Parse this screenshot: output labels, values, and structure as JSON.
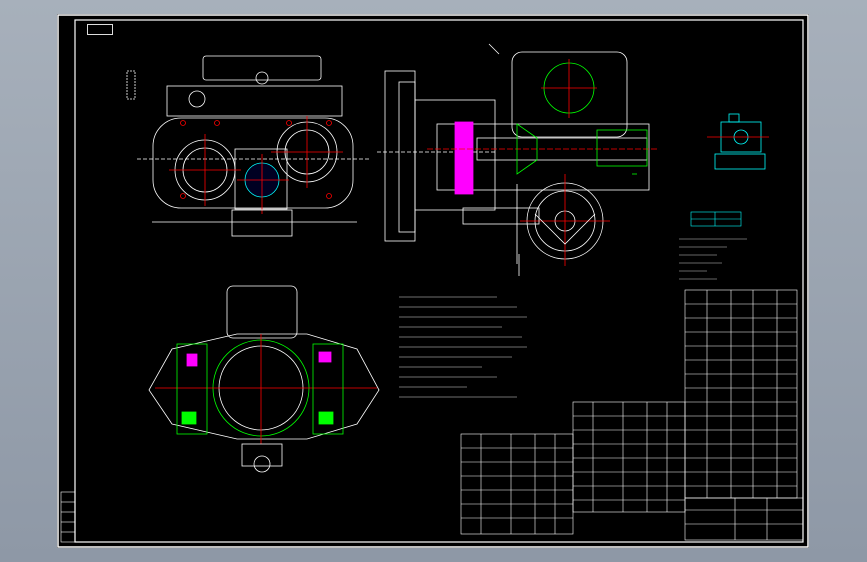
{
  "viewer": {
    "background": "#9aa4b1",
    "sheet_background": "#000000"
  },
  "drawing": {
    "tag_label": "",
    "notes_title": "",
    "drawing_number": "",
    "colors": {
      "outline": "#ffffff",
      "hatch": "#ff00ff",
      "green": "#00ff00",
      "red": "#ff0000",
      "cyan": "#00ffff",
      "yellow": "#ffff00"
    }
  }
}
